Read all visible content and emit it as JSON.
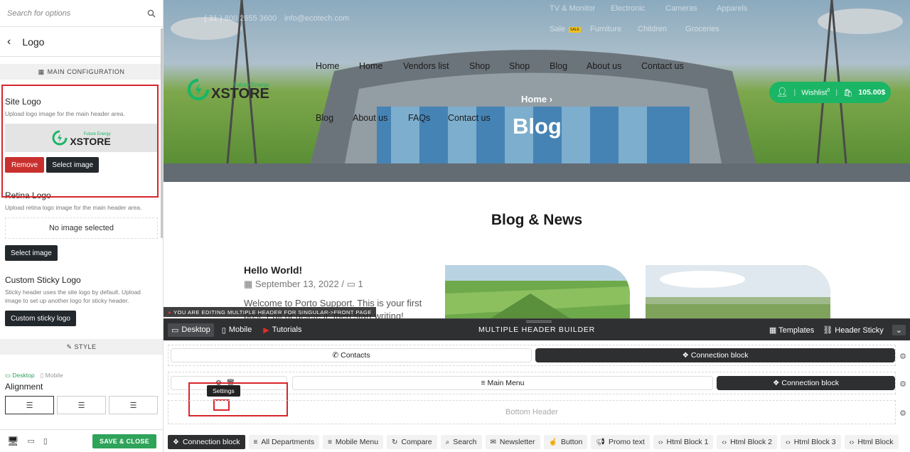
{
  "panel": {
    "search_placeholder": "Search for options",
    "back_title": "Logo",
    "main_config_label": "MAIN CONFIGURATION",
    "site_logo": {
      "title": "Site Logo",
      "desc": "Upload logo image for the main header area.",
      "remove_label": "Remove",
      "select_label": "Select image"
    },
    "retina_logo": {
      "title": "Retina Logo",
      "desc": "Upload retina logo image for the main header area.",
      "no_image": "No image selected",
      "select_label": "Select image"
    },
    "sticky_logo": {
      "title": "Custom Sticky Logo",
      "desc": "Sticky header uses the site logo by default. Upload image to set up another logo for sticky header.",
      "button_label": "Custom sticky logo"
    },
    "style_label": "STYLE",
    "device_desktop": "Desktop",
    "device_mobile": "Mobile",
    "alignment_label": "Alignment",
    "save_label": "SAVE & CLOSE"
  },
  "logo": {
    "tagline": "Future Energy",
    "name": "XSTORE"
  },
  "preview": {
    "topbar_phone": "( 31 ) 800 2655 3600",
    "topbar_email": "info@ecotech.com",
    "topbar_links": [
      "TV & Monitor",
      "Electronic",
      "Cameras",
      "Apparels"
    ],
    "topbar_links2": [
      "Sale",
      "Furniture",
      "Children",
      "Groceries"
    ],
    "sale_badge": "SALE",
    "nav_row1": [
      "Home",
      "Home",
      "Vendors list",
      "Shop",
      "Shop",
      "Blog",
      "About us",
      "Contact us"
    ],
    "nav_row2": [
      "Blog",
      "About us",
      "FAQs",
      "Contact us"
    ],
    "breadcrumb": "Home",
    "hero_title": "Blog",
    "wishlist_label": "Wishlist",
    "wishlist_count": "0",
    "cart_total": "105.00$",
    "blog_heading": "Blog & News",
    "post": {
      "title": "Hello World!",
      "date": "September 13, 2022",
      "comments": "1",
      "excerpt_line1": "Welcome to Porto Support. This is your first",
      "excerpt_line2": "post. Edit or delete it, then start writing!"
    },
    "editing_banner": "YOU ARE EDITING MULTIPLE HEADER FOR SINGULAR->FRONT PAGE"
  },
  "builder": {
    "tab_desktop": "Desktop",
    "tab_mobile": "Mobile",
    "tab_tutorials": "Tutorials",
    "title": "MULTIPLE HEADER BUILDER",
    "templates": "Templates",
    "header_sticky": "Header Sticky",
    "row1_left": "Contacts",
    "row1_right": "Connection block",
    "row2_center": "Main Menu",
    "row2_right": "Connection block",
    "tooltip": "Settings",
    "bottom_header": "Bottom Header",
    "palette": [
      "Connection block",
      "All Departments",
      "Mobile Menu",
      "Compare",
      "Search",
      "Newsletter",
      "Button",
      "Promo text",
      "Html Block 1",
      "Html Block 2",
      "Html Block 3",
      "Html Block"
    ]
  },
  "colors": {
    "accent_green": "#1bb566",
    "highlight_red": "#d7262c",
    "builder_dark": "#2f3032"
  }
}
